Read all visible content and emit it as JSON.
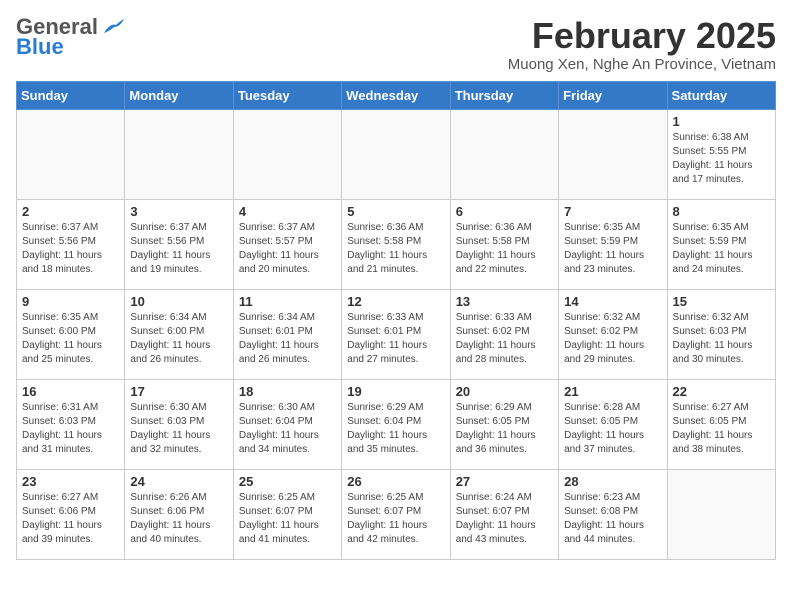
{
  "header": {
    "logo_general": "General",
    "logo_blue": "Blue",
    "title": "February 2025",
    "subtitle": "Muong Xen, Nghe An Province, Vietnam"
  },
  "weekdays": [
    "Sunday",
    "Monday",
    "Tuesday",
    "Wednesday",
    "Thursday",
    "Friday",
    "Saturday"
  ],
  "weeks": [
    [
      {
        "day": "",
        "info": ""
      },
      {
        "day": "",
        "info": ""
      },
      {
        "day": "",
        "info": ""
      },
      {
        "day": "",
        "info": ""
      },
      {
        "day": "",
        "info": ""
      },
      {
        "day": "",
        "info": ""
      },
      {
        "day": "1",
        "info": "Sunrise: 6:38 AM\nSunset: 5:55 PM\nDaylight: 11 hours\nand 17 minutes."
      }
    ],
    [
      {
        "day": "2",
        "info": "Sunrise: 6:37 AM\nSunset: 5:56 PM\nDaylight: 11 hours\nand 18 minutes."
      },
      {
        "day": "3",
        "info": "Sunrise: 6:37 AM\nSunset: 5:56 PM\nDaylight: 11 hours\nand 19 minutes."
      },
      {
        "day": "4",
        "info": "Sunrise: 6:37 AM\nSunset: 5:57 PM\nDaylight: 11 hours\nand 20 minutes."
      },
      {
        "day": "5",
        "info": "Sunrise: 6:36 AM\nSunset: 5:58 PM\nDaylight: 11 hours\nand 21 minutes."
      },
      {
        "day": "6",
        "info": "Sunrise: 6:36 AM\nSunset: 5:58 PM\nDaylight: 11 hours\nand 22 minutes."
      },
      {
        "day": "7",
        "info": "Sunrise: 6:35 AM\nSunset: 5:59 PM\nDaylight: 11 hours\nand 23 minutes."
      },
      {
        "day": "8",
        "info": "Sunrise: 6:35 AM\nSunset: 5:59 PM\nDaylight: 11 hours\nand 24 minutes."
      }
    ],
    [
      {
        "day": "9",
        "info": "Sunrise: 6:35 AM\nSunset: 6:00 PM\nDaylight: 11 hours\nand 25 minutes."
      },
      {
        "day": "10",
        "info": "Sunrise: 6:34 AM\nSunset: 6:00 PM\nDaylight: 11 hours\nand 26 minutes."
      },
      {
        "day": "11",
        "info": "Sunrise: 6:34 AM\nSunset: 6:01 PM\nDaylight: 11 hours\nand 26 minutes."
      },
      {
        "day": "12",
        "info": "Sunrise: 6:33 AM\nSunset: 6:01 PM\nDaylight: 11 hours\nand 27 minutes."
      },
      {
        "day": "13",
        "info": "Sunrise: 6:33 AM\nSunset: 6:02 PM\nDaylight: 11 hours\nand 28 minutes."
      },
      {
        "day": "14",
        "info": "Sunrise: 6:32 AM\nSunset: 6:02 PM\nDaylight: 11 hours\nand 29 minutes."
      },
      {
        "day": "15",
        "info": "Sunrise: 6:32 AM\nSunset: 6:03 PM\nDaylight: 11 hours\nand 30 minutes."
      }
    ],
    [
      {
        "day": "16",
        "info": "Sunrise: 6:31 AM\nSunset: 6:03 PM\nDaylight: 11 hours\nand 31 minutes."
      },
      {
        "day": "17",
        "info": "Sunrise: 6:30 AM\nSunset: 6:03 PM\nDaylight: 11 hours\nand 32 minutes."
      },
      {
        "day": "18",
        "info": "Sunrise: 6:30 AM\nSunset: 6:04 PM\nDaylight: 11 hours\nand 34 minutes."
      },
      {
        "day": "19",
        "info": "Sunrise: 6:29 AM\nSunset: 6:04 PM\nDaylight: 11 hours\nand 35 minutes."
      },
      {
        "day": "20",
        "info": "Sunrise: 6:29 AM\nSunset: 6:05 PM\nDaylight: 11 hours\nand 36 minutes."
      },
      {
        "day": "21",
        "info": "Sunrise: 6:28 AM\nSunset: 6:05 PM\nDaylight: 11 hours\nand 37 minutes."
      },
      {
        "day": "22",
        "info": "Sunrise: 6:27 AM\nSunset: 6:05 PM\nDaylight: 11 hours\nand 38 minutes."
      }
    ],
    [
      {
        "day": "23",
        "info": "Sunrise: 6:27 AM\nSunset: 6:06 PM\nDaylight: 11 hours\nand 39 minutes."
      },
      {
        "day": "24",
        "info": "Sunrise: 6:26 AM\nSunset: 6:06 PM\nDaylight: 11 hours\nand 40 minutes."
      },
      {
        "day": "25",
        "info": "Sunrise: 6:25 AM\nSunset: 6:07 PM\nDaylight: 11 hours\nand 41 minutes."
      },
      {
        "day": "26",
        "info": "Sunrise: 6:25 AM\nSunset: 6:07 PM\nDaylight: 11 hours\nand 42 minutes."
      },
      {
        "day": "27",
        "info": "Sunrise: 6:24 AM\nSunset: 6:07 PM\nDaylight: 11 hours\nand 43 minutes."
      },
      {
        "day": "28",
        "info": "Sunrise: 6:23 AM\nSunset: 6:08 PM\nDaylight: 11 hours\nand 44 minutes."
      },
      {
        "day": "",
        "info": ""
      }
    ]
  ]
}
